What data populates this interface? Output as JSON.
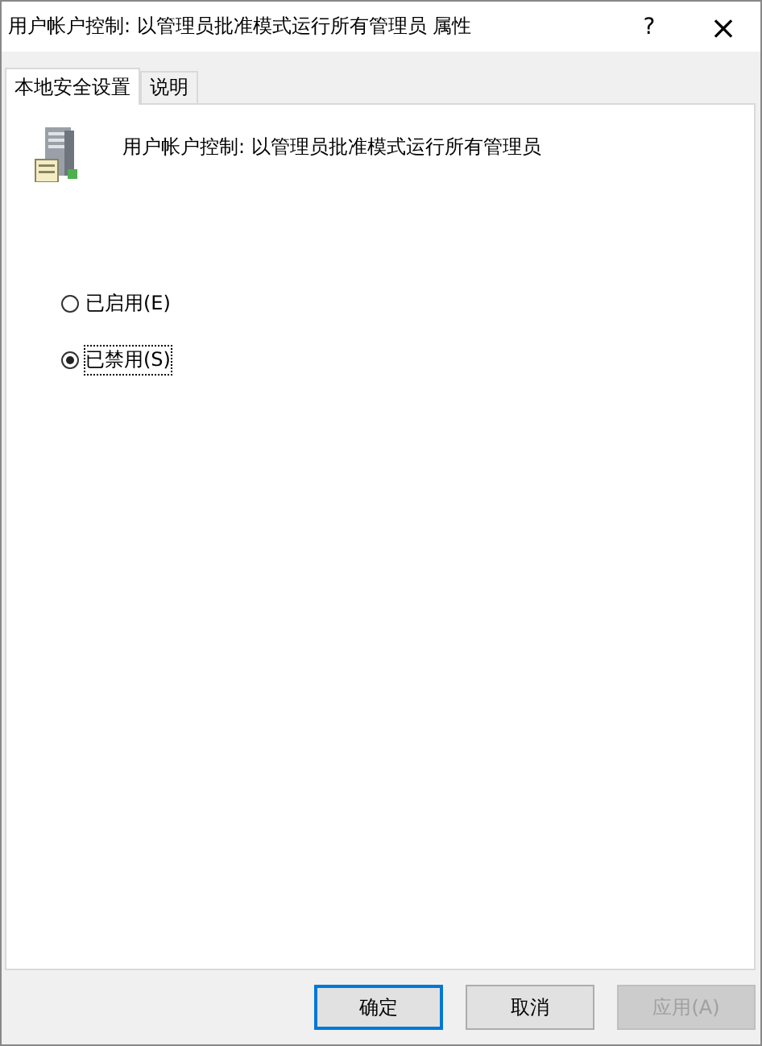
{
  "window": {
    "title": "用户帐户控制: 以管理员批准模式运行所有管理员 属性",
    "help": "?",
    "close": "×"
  },
  "tabs": [
    {
      "label": "本地安全设置",
      "selected": true
    },
    {
      "label": "说明",
      "selected": false
    }
  ],
  "policy_title": "用户帐户控制: 以管理员批准模式运行所有管理员",
  "options": [
    {
      "label": "已启用(E)",
      "selected": false
    },
    {
      "label": "已禁用(S)",
      "selected": true
    }
  ],
  "buttons": [
    {
      "label": "确定",
      "default": true,
      "disabled": false
    },
    {
      "label": "取消",
      "default": false,
      "disabled": false
    },
    {
      "label": "应用(A)",
      "default": false,
      "disabled": true
    }
  ]
}
